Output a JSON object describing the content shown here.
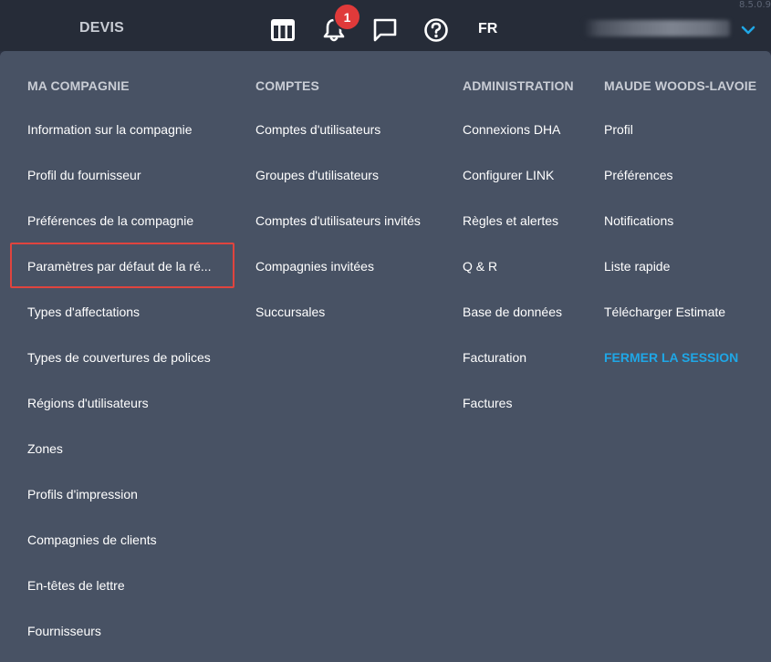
{
  "version": "8.5.0.9",
  "header": {
    "title": "DEVIS",
    "notification_count": "1",
    "language": "FR",
    "icons": [
      "dashboard-icon",
      "bell-icon",
      "chat-icon",
      "help-icon",
      "chevron-down-icon"
    ]
  },
  "menu": {
    "columns": [
      {
        "title": "MA COMPAGNIE",
        "items": [
          "Information sur la compagnie",
          "Profil du fournisseur",
          "Préférences de la compagnie",
          "Paramètres par défaut de la ré...",
          "Types d'affectations",
          "Types de couvertures de polices",
          "Régions d'utilisateurs",
          "Zones",
          "Profils d'impression",
          "Compagnies de clients",
          "En-têtes de lettre",
          "Fournisseurs"
        ]
      },
      {
        "title": "COMPTES",
        "items": [
          "Comptes d'utilisateurs",
          "Groupes d'utilisateurs",
          "Comptes d'utilisateurs invités",
          "Compagnies invitées",
          "Succursales"
        ]
      },
      {
        "title": "ADMINISTRATION",
        "items": [
          "Connexions DHA",
          "Configurer LINK",
          "Règles et alertes",
          "Q & R",
          "Base de données",
          "Facturation",
          "Factures"
        ]
      },
      {
        "title": "MAUDE WOODS-LAVOIE",
        "items": [
          "Profil",
          "Préférences",
          "Notifications",
          "Liste rapide",
          "Télécharger Estimate"
        ],
        "logout": "FERMER LA SESSION"
      }
    ]
  },
  "colors": {
    "topbar": "#262c38",
    "panel": "#485264",
    "accent": "#1fa7e6",
    "badge": "#e03a3a",
    "highlight": "#e0443e"
  }
}
